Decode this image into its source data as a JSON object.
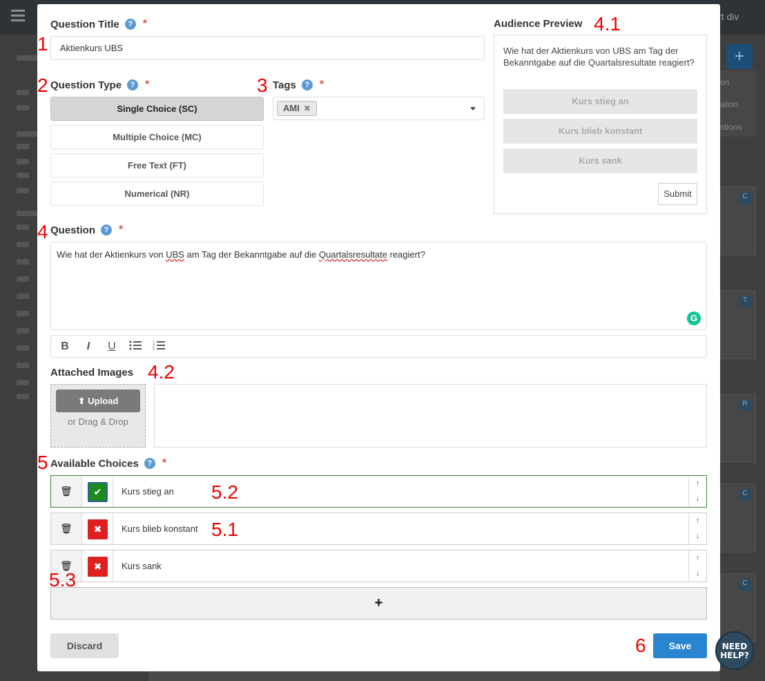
{
  "background": {
    "topbar_right": "rt  div",
    "side_menu": [
      "on",
      "ation",
      "stions"
    ]
  },
  "title_section": {
    "label": "Question Title",
    "value": "Aktienkurs UBS"
  },
  "type_section": {
    "label": "Question Type",
    "options": [
      "Single Choice (SC)",
      "Multiple Choice (MC)",
      "Free Text (FT)",
      "Numerical (NR)"
    ],
    "selected": "Single Choice (SC)"
  },
  "tags_section": {
    "label": "Tags",
    "tags": [
      "AMI"
    ]
  },
  "preview": {
    "label": "Audience Preview",
    "question": "Wie hat der Aktienkurs von UBS am Tag der Bekanntgabe auf die Quartalsresultate reagiert?",
    "choices": [
      "Kurs stieg an",
      "Kurs blieb konstant",
      "Kurs sank"
    ],
    "submit": "Submit"
  },
  "question_section": {
    "label": "Question",
    "text_before": "Wie hat der Aktienkurs von ",
    "text_ubs": "UBS",
    "text_middle": " am Tag der Bekanntgabe auf die ",
    "text_quartal": "Quartalsresultate",
    "text_after": " reagiert?",
    "toolbar": [
      "B",
      "I",
      "U",
      "bulleted-list",
      "numbered-list"
    ]
  },
  "images_section": {
    "label": "Attached Images",
    "upload": "Upload",
    "drag": "or Drag & Drop"
  },
  "choices_section": {
    "label": "Available Choices",
    "items": [
      {
        "text": "Kurs stieg an",
        "correct": true
      },
      {
        "text": "Kurs blieb konstant",
        "correct": false
      },
      {
        "text": "Kurs sank",
        "correct": false
      }
    ],
    "add": "+"
  },
  "actions": {
    "discard": "Discard",
    "save": "Save"
  },
  "annotations": [
    "1",
    "2",
    "3",
    "4",
    "4.1",
    "4.2",
    "5",
    "5.1",
    "5.2",
    "5.3",
    "6"
  ],
  "need_help": {
    "line1": "NEED",
    "line2": "HELP?"
  },
  "colors": {
    "accent": "#2a85d0",
    "correct": "#1e8b1e",
    "wrong": "#e02020",
    "annotation": "#e00000"
  }
}
